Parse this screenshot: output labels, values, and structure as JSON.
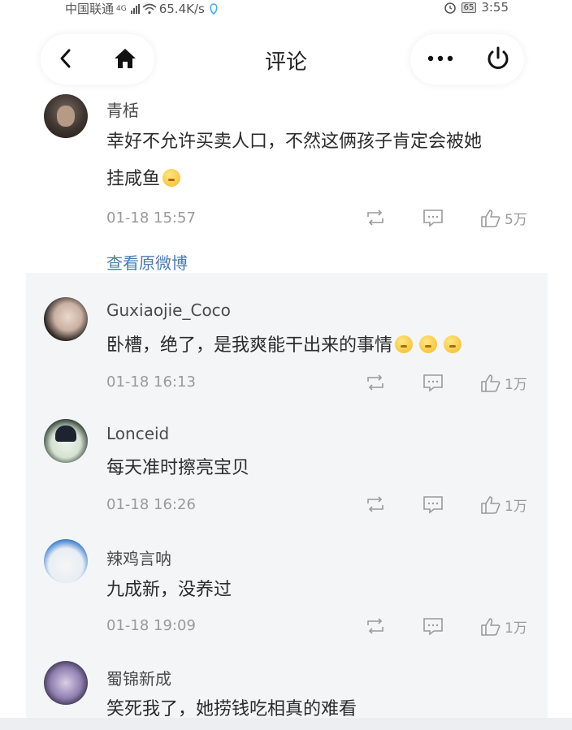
{
  "status_bar": {
    "carrier": "中国联通",
    "network": "4G",
    "speed": "65.4K/s",
    "battery": "65",
    "time": "3:55"
  },
  "header": {
    "title": "评论",
    "back_icon": "chevron-left-icon",
    "home_icon": "home-icon",
    "more_icon": "more-dots-icon",
    "power_icon": "power-icon"
  },
  "view_original": "查看原微博",
  "comments": [
    {
      "username": "青栝",
      "lines": [
        "幸好不允许买卖人口，不然这俩孩子肯定会被她",
        "挂咸鱼"
      ],
      "emoji_count": 1,
      "time": "01-18 15:57",
      "likes": "5万"
    },
    {
      "username": "Guxiaojie_Coco",
      "lines": [
        "卧槽，绝了，是我爽能干出来的事情"
      ],
      "emoji_count": 3,
      "time": "01-18 16:13",
      "likes": "1万"
    },
    {
      "username": "Lonceid",
      "lines": [
        "每天准时擦亮宝贝"
      ],
      "emoji_count": 0,
      "time": "01-18 16:26",
      "likes": "1万"
    },
    {
      "username": "辣鸡言呐",
      "lines": [
        "九成新，没养过"
      ],
      "emoji_count": 0,
      "time": "01-18 19:09",
      "likes": "1万"
    },
    {
      "username": "蜀锦新成",
      "lines": [
        "笑死我了，她捞钱吃相真的难看"
      ],
      "emoji_count": 0,
      "time": "",
      "likes": ""
    }
  ],
  "colors": {
    "link": "#4a7cb0",
    "meta": "#9a9a9a",
    "grey_panel": "#f4f5f7"
  }
}
